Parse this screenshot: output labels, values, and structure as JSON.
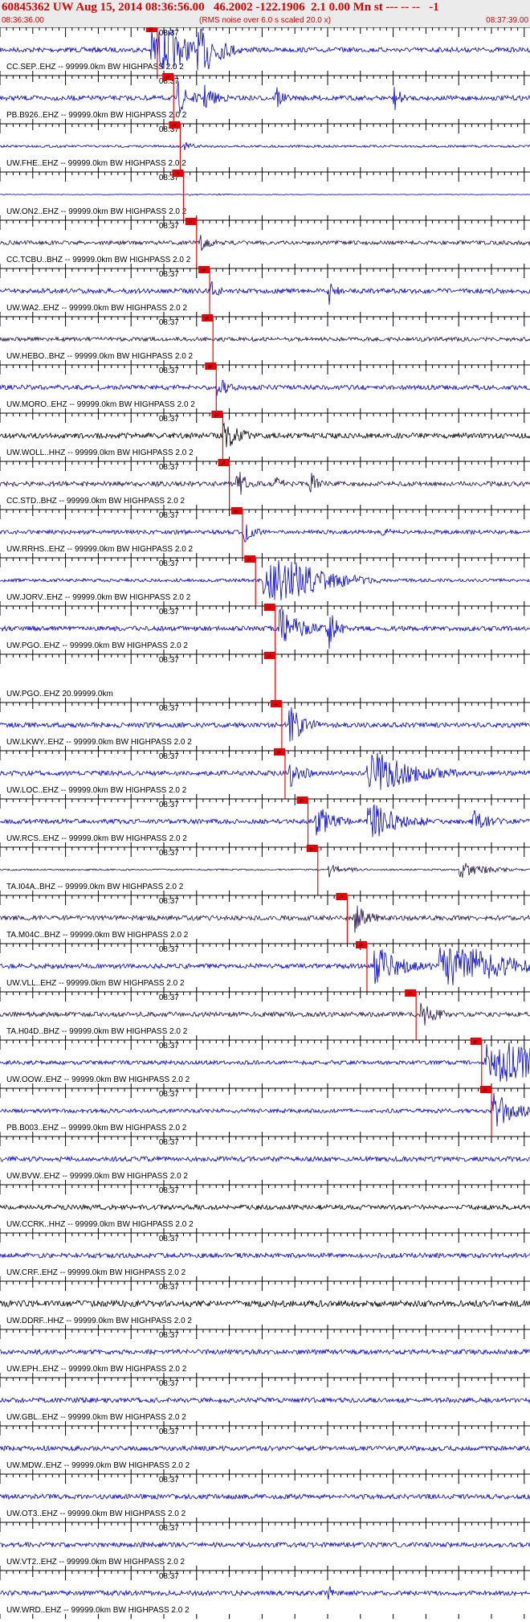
{
  "header": {
    "title": "60845362 UW Aug 15, 2014 08:36:56.00   46.2002 -122.1906  2.1 0.00 Mn st --- -- --   -1",
    "start_time": "08:36:36.00",
    "end_time": "08:37:39.00",
    "rms_note": "(RMS noise over 6.0 s scaled 20.0 x)",
    "minute_label": "08:37"
  },
  "colors": {
    "header_bg": "#ebebeb",
    "title_text": "#e00000",
    "pick_line": "#ff0000",
    "pick_box": "#ee0000",
    "trace_blue": "#0000dd",
    "trace_black": "#000000",
    "trace_navy": "#22104a",
    "axis": "#000000"
  },
  "chart_data": {
    "type": "seismogram",
    "x_unit": "time (UTC)",
    "xlim": [
      "08:36:36.00",
      "08:37:39.00"
    ],
    "minute_marker": "08:37",
    "pick_label": "P",
    "traces": [
      {
        "label": "CC.SEP..EHZ -- 99999.0km BW  HIGHPASS  2.0  2",
        "pick_s": 24,
        "color": "blue",
        "amp": 3,
        "events": [
          [
            23,
            10,
            5
          ],
          [
            30,
            7,
            4
          ]
        ]
      },
      {
        "label": "PB.B926..EHZ -- 99999.0km BW  HIGHPASS  2.0  2",
        "pick_s": 26.5,
        "color": "blue",
        "amp": 3,
        "events": [
          [
            27,
            4,
            2
          ],
          [
            31,
            4,
            1.5
          ],
          [
            42,
            2,
            2
          ],
          [
            60,
            2,
            2
          ]
        ]
      },
      {
        "label": "UW.FHE..EHZ -- 99999.0km BW  HIGHPASS  2.0  2",
        "pick_s": 27.5,
        "color": "blue",
        "amp": 1.5,
        "events": [
          [
            28,
            4,
            0.8
          ]
        ]
      },
      {
        "label": "UW.ON2..EHZ -- 99999.0km BW  HIGHPASS  2.0  2",
        "pick_s": 28,
        "color": "blue",
        "amp": 0.4,
        "events": [
          [
            28.5,
            6,
            0.6
          ],
          [
            33,
            5,
            0.5
          ]
        ]
      },
      {
        "label": "CC.TCBU..BHZ -- 99999.0km BW  HIGHPASS  2.0  2",
        "pick_s": 30,
        "color": "navy",
        "amp": 2.5,
        "events": [
          [
            30.5,
            2.5,
            1.5
          ]
        ]
      },
      {
        "label": "UW.WA2..EHZ -- 99999.0km BW  HIGHPASS  2.0  2",
        "pick_s": 32,
        "color": "blue",
        "amp": 3,
        "events": [
          [
            32,
            2,
            1.5
          ],
          [
            50,
            2,
            2
          ]
        ]
      },
      {
        "label": "UW.HEBO..BHZ -- 99999.0km BW  HIGHPASS  2.0  2",
        "pick_s": 32.5,
        "color": "navy",
        "amp": 2.5,
        "events": []
      },
      {
        "label": "UW.MORO..EHZ -- 99999.0km BW  HIGHPASS  2.0  2",
        "pick_s": 33,
        "color": "blue",
        "amp": 3,
        "events": [
          [
            33,
            3,
            1.5
          ]
        ]
      },
      {
        "label": "UW.WOLL..HHZ -- 99999.0km BW  HIGHPASS  2.0  2",
        "pick_s": 34,
        "color": "black",
        "amp": 3.5,
        "events": [
          [
            34,
            5,
            1.5
          ]
        ]
      },
      {
        "label": "CC.STD..BHZ -- 99999.0km BW  HIGHPASS  2.0  2",
        "pick_s": 35,
        "color": "navy",
        "amp": 3,
        "events": [
          [
            36,
            3,
            2
          ],
          [
            42,
            2,
            2
          ],
          [
            47,
            3,
            2
          ]
        ]
      },
      {
        "label": "UW.RRHS..EHZ -- 99999.0km BW  HIGHPASS  2.0  2",
        "pick_s": 37,
        "color": "blue",
        "amp": 2.5,
        "events": [
          [
            37,
            3,
            2
          ],
          [
            58,
            2,
            1
          ]
        ]
      },
      {
        "label": "UW.JORV..EHZ -- 99999.0km BW  HIGHPASS  2.0  2",
        "pick_s": 39,
        "color": "blue",
        "amp": 2,
        "events": [
          [
            40,
            18,
            6
          ]
        ]
      },
      {
        "label": "UW.PGO..EHZ -- 99999.0km BW  HIGHPASS  2.0  2",
        "pick_s": 42,
        "color": "blue",
        "amp": 3,
        "events": [
          [
            42.5,
            8,
            2.5
          ],
          [
            50,
            3,
            3
          ]
        ]
      },
      {
        "label": "UW.PGO..EHZ 20.99999.0km",
        "pick_s": 42,
        "color": "none",
        "amp": 0,
        "events": []
      },
      {
        "label": "UW.LKWY..EHZ -- 99999.0km BW  HIGHPASS  2.0  2",
        "pick_s": 43,
        "color": "blue",
        "amp": 3,
        "events": [
          [
            44,
            5,
            2.5
          ]
        ]
      },
      {
        "label": "UW.LOC..EHZ -- 99999.0km BW  HIGHPASS  2.0  2",
        "pick_s": 43.5,
        "color": "blue",
        "amp": 3,
        "events": [
          [
            44,
            4,
            2
          ],
          [
            56,
            14,
            3
          ]
        ]
      },
      {
        "label": "UW.RCS..EHZ -- 99999.0km BW  HIGHPASS  2.0  2",
        "pick_s": 47,
        "color": "blue",
        "amp": 3,
        "events": [
          [
            48,
            6,
            2
          ],
          [
            56,
            10,
            2.5
          ],
          [
            72,
            5,
            1.5
          ]
        ]
      },
      {
        "label": "TA.I04A..BHZ -- 99999.0km BW  HIGHPASS  2.0  2",
        "pick_s": 48.5,
        "color": "navy",
        "amp": 1,
        "events": [
          [
            50,
            6,
            2.5
          ],
          [
            70,
            10,
            3
          ]
        ]
      },
      {
        "label": "TA.M04C..BHZ -- 99999.0km BW  HIGHPASS  2.0  2",
        "pick_s": 53,
        "color": "navy",
        "amp": 3,
        "events": [
          [
            54,
            4,
            2
          ]
        ]
      },
      {
        "label": "UW.VLL..EHZ -- 99999.0km BW  HIGHPASS  2.0  2",
        "pick_s": 56,
        "color": "blue",
        "amp": 3,
        "events": [
          [
            57,
            9,
            2.5
          ],
          [
            67,
            18,
            4
          ]
        ]
      },
      {
        "label": "TA.H04D..BHZ -- 99999.0km BW  HIGHPASS  2.0  2",
        "pick_s": 63.5,
        "color": "navy",
        "amp": 3,
        "events": [
          [
            64,
            5,
            1.5
          ]
        ]
      },
      {
        "label": "UW.OOW..EHZ -- 99999.0km BW  HIGHPASS  2.0  2",
        "pick_s": 73.5,
        "color": "blue",
        "amp": 2.5,
        "events": [
          [
            74,
            22,
            4
          ]
        ]
      },
      {
        "label": "PB.B003..EHZ -- 99999.0km BW  HIGHPASS  2.0  2",
        "pick_s": 75,
        "color": "blue",
        "amp": 2.5,
        "events": [
          [
            75,
            9,
            2.5
          ]
        ]
      },
      {
        "label": "UW.BVW..EHZ -- 99999.0km BW  HIGHPASS  2.0  2",
        "pick_s": null,
        "color": "blue",
        "amp": 3,
        "events": []
      },
      {
        "label": "UW.CCRK..HHZ -- 99999.0km BW  HIGHPASS  2.0  2",
        "pick_s": null,
        "color": "black",
        "amp": 3,
        "events": []
      },
      {
        "label": "UW.CRF..EHZ -- 99999.0km BW  HIGHPASS  2.0  2",
        "pick_s": null,
        "color": "blue",
        "amp": 3,
        "events": []
      },
      {
        "label": "UW.DDRF..HHZ -- 99999.0km BW  HIGHPASS  2.0  2",
        "pick_s": null,
        "color": "black",
        "amp": 4,
        "events": []
      },
      {
        "label": "UW.EPH..EHZ -- 99999.0km BW  HIGHPASS  2.0  2",
        "pick_s": null,
        "color": "blue",
        "amp": 3,
        "events": []
      },
      {
        "label": "UW.GBL..EHZ -- 99999.0km BW  HIGHPASS  2.0  2",
        "pick_s": null,
        "color": "blue",
        "amp": 3,
        "events": []
      },
      {
        "label": "UW.MDW..EHZ -- 99999.0km BW  HIGHPASS  2.0  2",
        "pick_s": null,
        "color": "blue",
        "amp": 3,
        "events": []
      },
      {
        "label": "UW.OT3..EHZ -- 99999.0km BW  HIGHPASS  2.0  2",
        "pick_s": null,
        "color": "blue",
        "amp": 3,
        "events": []
      },
      {
        "label": "UW.VT2..EHZ -- 99999.0km BW  HIGHPASS  2.0  2",
        "pick_s": null,
        "color": "blue",
        "amp": 3,
        "events": []
      },
      {
        "label": "UW.WRD..EHZ -- 99999.0km BW  HIGHPASS  2.0  2",
        "pick_s": null,
        "color": "blue",
        "amp": 3,
        "events": [
          [
            50,
            1,
            2
          ]
        ]
      }
    ]
  }
}
